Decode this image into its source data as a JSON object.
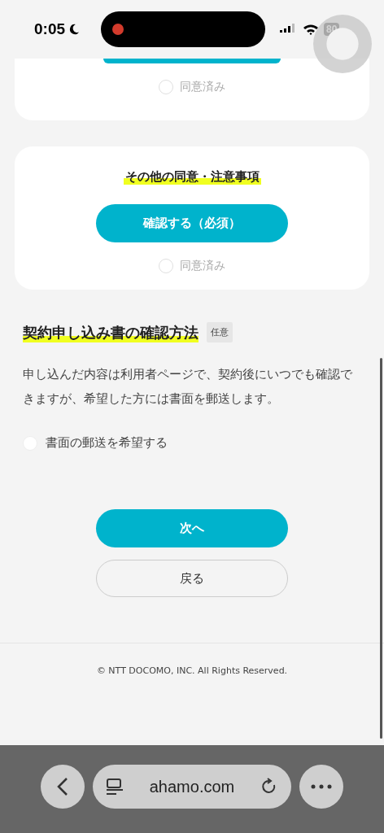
{
  "status_bar": {
    "time": "0:05",
    "battery": "80"
  },
  "consent_cards": [
    {
      "checkbox": {
        "label": "同意済み",
        "checked": false
      }
    },
    {
      "title": "その他の同意・注意事項",
      "button": "確認する（必須）",
      "checkbox": {
        "label": "同意済み",
        "checked": false
      }
    }
  ],
  "section": {
    "title": "契約申し込み書の確認方法",
    "badge": "任意",
    "description": "申し込んだ内容は利用者ページで、契約後にいつでも確認できますが、希望した方には書面を郵送します。",
    "option": {
      "label": "書面の郵送を希望する",
      "selected": false
    }
  },
  "buttons": [
    {
      "label": "次へ",
      "kind": "primary"
    },
    {
      "label": "戻る",
      "kind": "secondary"
    }
  ],
  "footer": {
    "copyright": "© NTT DOCOMO, INC. All Rights Reserved."
  },
  "browser_bar": {
    "url": "ahamo.com"
  }
}
